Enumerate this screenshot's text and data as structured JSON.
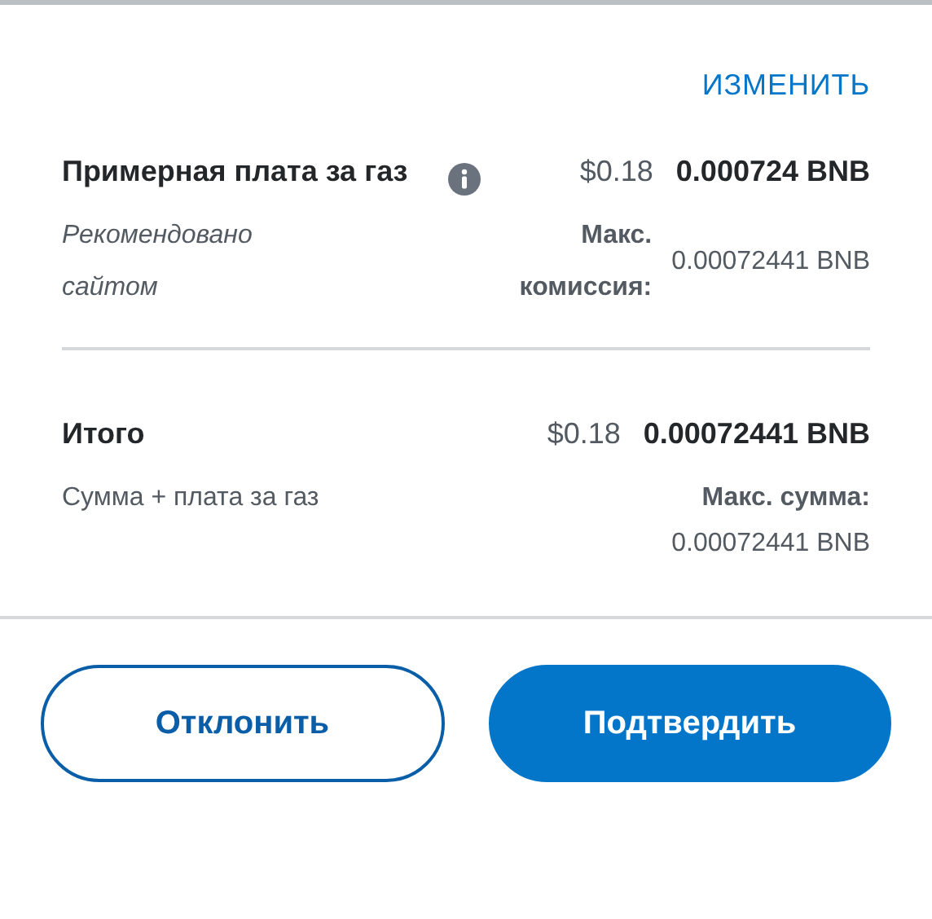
{
  "edit_link": "ИЗМЕНИТЬ",
  "gas_fee": {
    "label": "Примерная плата за газ",
    "fiat": "$0.18",
    "amount": "0.000724 BNB",
    "note": "Рекомендовано сайтом",
    "max_label": "Макс. комиссия:",
    "max_value": "0.00072441 BNB"
  },
  "total": {
    "label": "Итого",
    "fiat": "$0.18",
    "amount": "0.00072441 BNB",
    "note": "Сумма + плата за газ",
    "max_label": "Макс. сумма:",
    "max_value": "0.00072441 BNB"
  },
  "buttons": [
    {
      "label": "Отклонить",
      "kind": "secondary"
    },
    {
      "label": "Подтвердить",
      "kind": "primary"
    }
  ]
}
